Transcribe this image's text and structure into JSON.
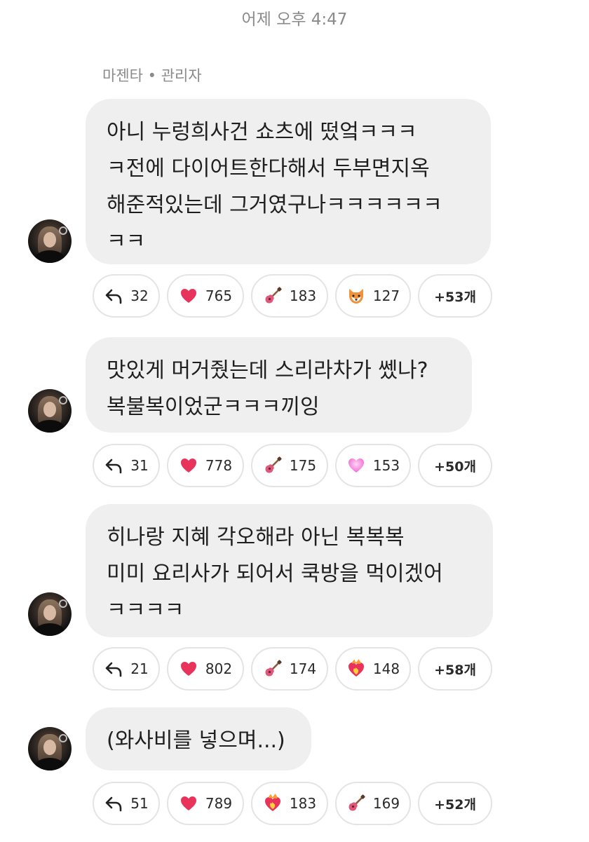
{
  "header": {
    "timestamp": "어제 오후 4:47",
    "sender": "마젠타 • 관리자"
  },
  "messages": [
    {
      "text": "아니 누렁희사건 쇼츠에 떴엌ㅋㅋㅋ\nㅋ전에 다이어트한다해서 두부면지옥\n해준적있는데 그거였구나ㅋㅋㅋㅋㅋㅋ\nㅋㅋ",
      "reactions": [
        {
          "type": "reply",
          "icon": "reply-arrow-icon",
          "count": "32"
        },
        {
          "type": "emoji",
          "icon": "red-heart-icon",
          "glyph": "❤️",
          "count": "765"
        },
        {
          "type": "emoji",
          "icon": "guitar-icon",
          "glyph": "🎸",
          "count": "183"
        },
        {
          "type": "emoji",
          "icon": "fox-face-icon",
          "glyph": "🦊",
          "count": "127"
        }
      ],
      "more": "+53개"
    },
    {
      "text": "맛있게 머거줬는데 스리라차가 쎘나?\n복불복이었군ㅋㅋㅋ끼잉",
      "reactions": [
        {
          "type": "reply",
          "icon": "reply-arrow-icon",
          "count": "31"
        },
        {
          "type": "emoji",
          "icon": "red-heart-icon",
          "glyph": "❤️",
          "count": "778"
        },
        {
          "type": "emoji",
          "icon": "guitar-icon",
          "glyph": "🎸",
          "count": "175"
        },
        {
          "type": "emoji",
          "icon": "pink-heart-icon",
          "glyph": "💗",
          "count": "153"
        }
      ],
      "more": "+50개"
    },
    {
      "text": "히나랑 지혜 각오해라 아닌 복복복\n미미 요리사가 되어서 쿡방을 먹이겠어\nㅋㅋㅋㅋ",
      "reactions": [
        {
          "type": "reply",
          "icon": "reply-arrow-icon",
          "count": "21"
        },
        {
          "type": "emoji",
          "icon": "red-heart-icon",
          "glyph": "❤️",
          "count": "802"
        },
        {
          "type": "emoji",
          "icon": "guitar-icon",
          "glyph": "🎸",
          "count": "174"
        },
        {
          "type": "emoji",
          "icon": "heart-on-fire-icon",
          "glyph": "❤️‍🔥",
          "count": "148"
        }
      ],
      "more": "+58개"
    },
    {
      "text": "(와사비를 넣으며...)",
      "reactions": [
        {
          "type": "reply",
          "icon": "reply-arrow-icon",
          "count": "51"
        },
        {
          "type": "emoji",
          "icon": "red-heart-icon",
          "glyph": "❤️",
          "count": "789"
        },
        {
          "type": "emoji",
          "icon": "heart-on-fire-icon",
          "glyph": "❤️‍🔥",
          "count": "183"
        },
        {
          "type": "emoji",
          "icon": "guitar-icon",
          "glyph": "🎸",
          "count": "169"
        }
      ],
      "more": "+52개"
    }
  ],
  "colors": {
    "bubble_bg": "#efefef",
    "pill_border": "#e4e4e4",
    "meta_text": "#8a8a8a",
    "heart": "#e8345a"
  }
}
